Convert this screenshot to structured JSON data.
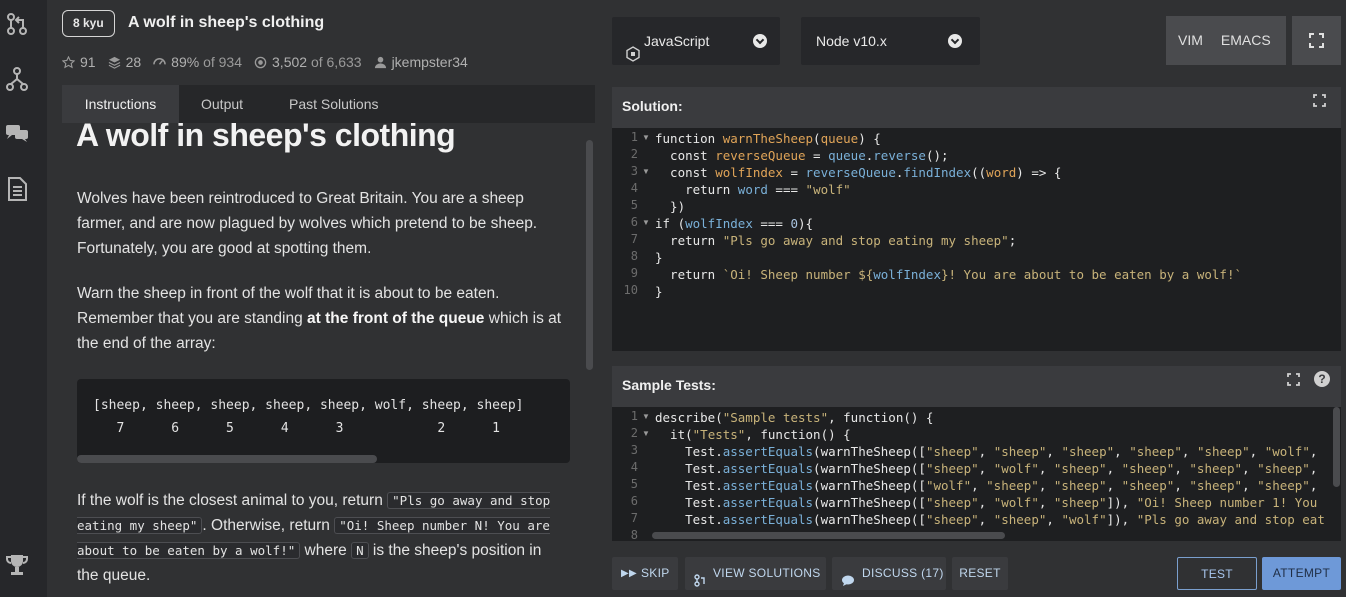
{
  "header": {
    "kyu": "8 kyu",
    "title": "A wolf in sheep's clothing",
    "stars": "91",
    "collections": "28",
    "satisfaction_pct": "89%",
    "satisfaction_of": "of 934",
    "completed": "3,502",
    "completed_of": "of 6,633",
    "author": "jkempster34"
  },
  "tabs": {
    "instructions": "Instructions",
    "output": "Output",
    "past": "Past Solutions"
  },
  "description": {
    "heading": "A wolf in sheep's clothing",
    "p1": "Wolves have been reintroduced to Great Britain. You are a sheep farmer, and are now plagued by wolves which pretend to be sheep. Fortunately, you are good at spotting them.",
    "p2_a": "Warn the sheep in front of the wolf that it is about to be eaten. Remember that you are standing ",
    "p2_b": "at the front of the queue",
    "p2_c": " which is at the end of the array:",
    "code_line1": "[sheep, sheep, sheep, sheep, sheep, wolf, sheep, sheep]      (",
    "code_line2": "   7      6      5      4      3            2      1",
    "p3_a": "If the wolf is the closest animal to you, return ",
    "p3_code1": "\"Pls go away and stop eating my sheep\"",
    "p3_b": ". Otherwise, return ",
    "p3_code2": "\"Oi! Sheep number N! You are about to be eaten by a wolf!\"",
    "p3_c": " where ",
    "p3_code3": "N",
    "p3_d": " is the sheep's position in the queue."
  },
  "toolbar": {
    "language": "JavaScript",
    "version": "Node v10.x",
    "vim": "VIM",
    "emacs": "EMACS"
  },
  "solution": {
    "title": "Solution:",
    "lines": [
      "1",
      "2",
      "3",
      "4",
      "5",
      "6",
      "7",
      "8",
      "9",
      "10"
    ]
  },
  "tests": {
    "title": "Sample Tests:",
    "lines": [
      "1",
      "2",
      "3",
      "4",
      "5",
      "6",
      "7",
      "8"
    ]
  },
  "bottom": {
    "skip": "SKIP",
    "view_solutions": "VIEW SOLUTIONS",
    "discuss": "DISCUSS (17)",
    "reset": "RESET",
    "test": "TEST",
    "attempt": "ATTEMPT"
  }
}
